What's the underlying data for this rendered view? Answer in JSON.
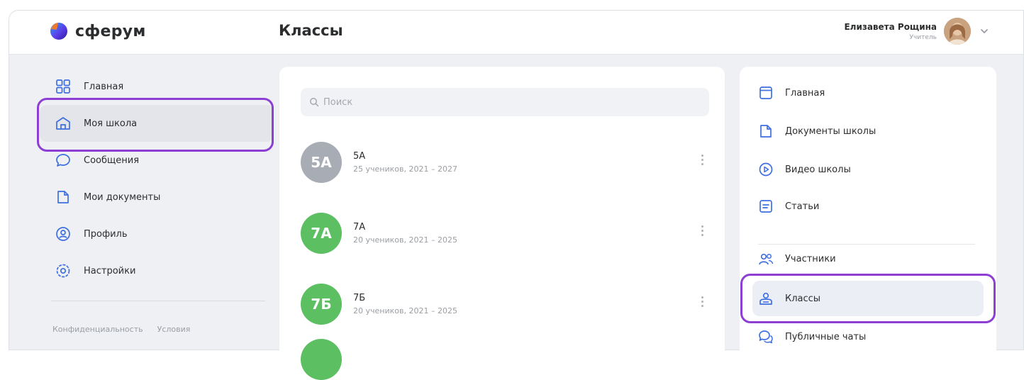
{
  "brand": {
    "name": "сферум"
  },
  "page_title": "Классы",
  "user": {
    "name": "Елизавета Рощина",
    "role": "Учитель"
  },
  "left_nav": {
    "items": [
      {
        "label": "Главная",
        "icon": "grid-icon"
      },
      {
        "label": "Моя школа",
        "icon": "school-icon",
        "active": true
      },
      {
        "label": "Сообщения",
        "icon": "chat-bubble-icon"
      },
      {
        "label": "Мои документы",
        "icon": "document-icon"
      },
      {
        "label": "Профиль",
        "icon": "profile-icon"
      },
      {
        "label": "Настройки",
        "icon": "gear-icon"
      }
    ],
    "footer": {
      "privacy": "Конфиденциальность",
      "terms": "Условия"
    }
  },
  "search": {
    "placeholder": "Поиск"
  },
  "classes": [
    {
      "badge": "5А",
      "name": "5А",
      "meta": "25 учеников, 2021 – 2027",
      "color": "#a8adb5"
    },
    {
      "badge": "7А",
      "name": "7А",
      "meta": "20 учеников, 2021 – 2025",
      "color": "#5cbf62"
    },
    {
      "badge": "7Б",
      "name": "7Б",
      "meta": "20 учеников, 2021 – 2025",
      "color": "#5cbf62"
    }
  ],
  "right_nav": {
    "items": [
      {
        "label": "Главная",
        "icon": "window-icon"
      },
      {
        "label": "Документы школы",
        "icon": "document-icon"
      },
      {
        "label": "Видео школы",
        "icon": "play-circle-icon"
      },
      {
        "label": "Статьи",
        "icon": "article-icon"
      },
      {
        "label": "Участники",
        "icon": "people-icon"
      },
      {
        "label": "Классы",
        "icon": "classes-icon",
        "active": true
      },
      {
        "label": "Публичные чаты",
        "icon": "chats-icon"
      }
    ]
  },
  "colors": {
    "accent": "#8d3fd4",
    "icon_blue": "#3f6fe0",
    "green": "#5cbf62",
    "gray": "#a8adb5"
  }
}
